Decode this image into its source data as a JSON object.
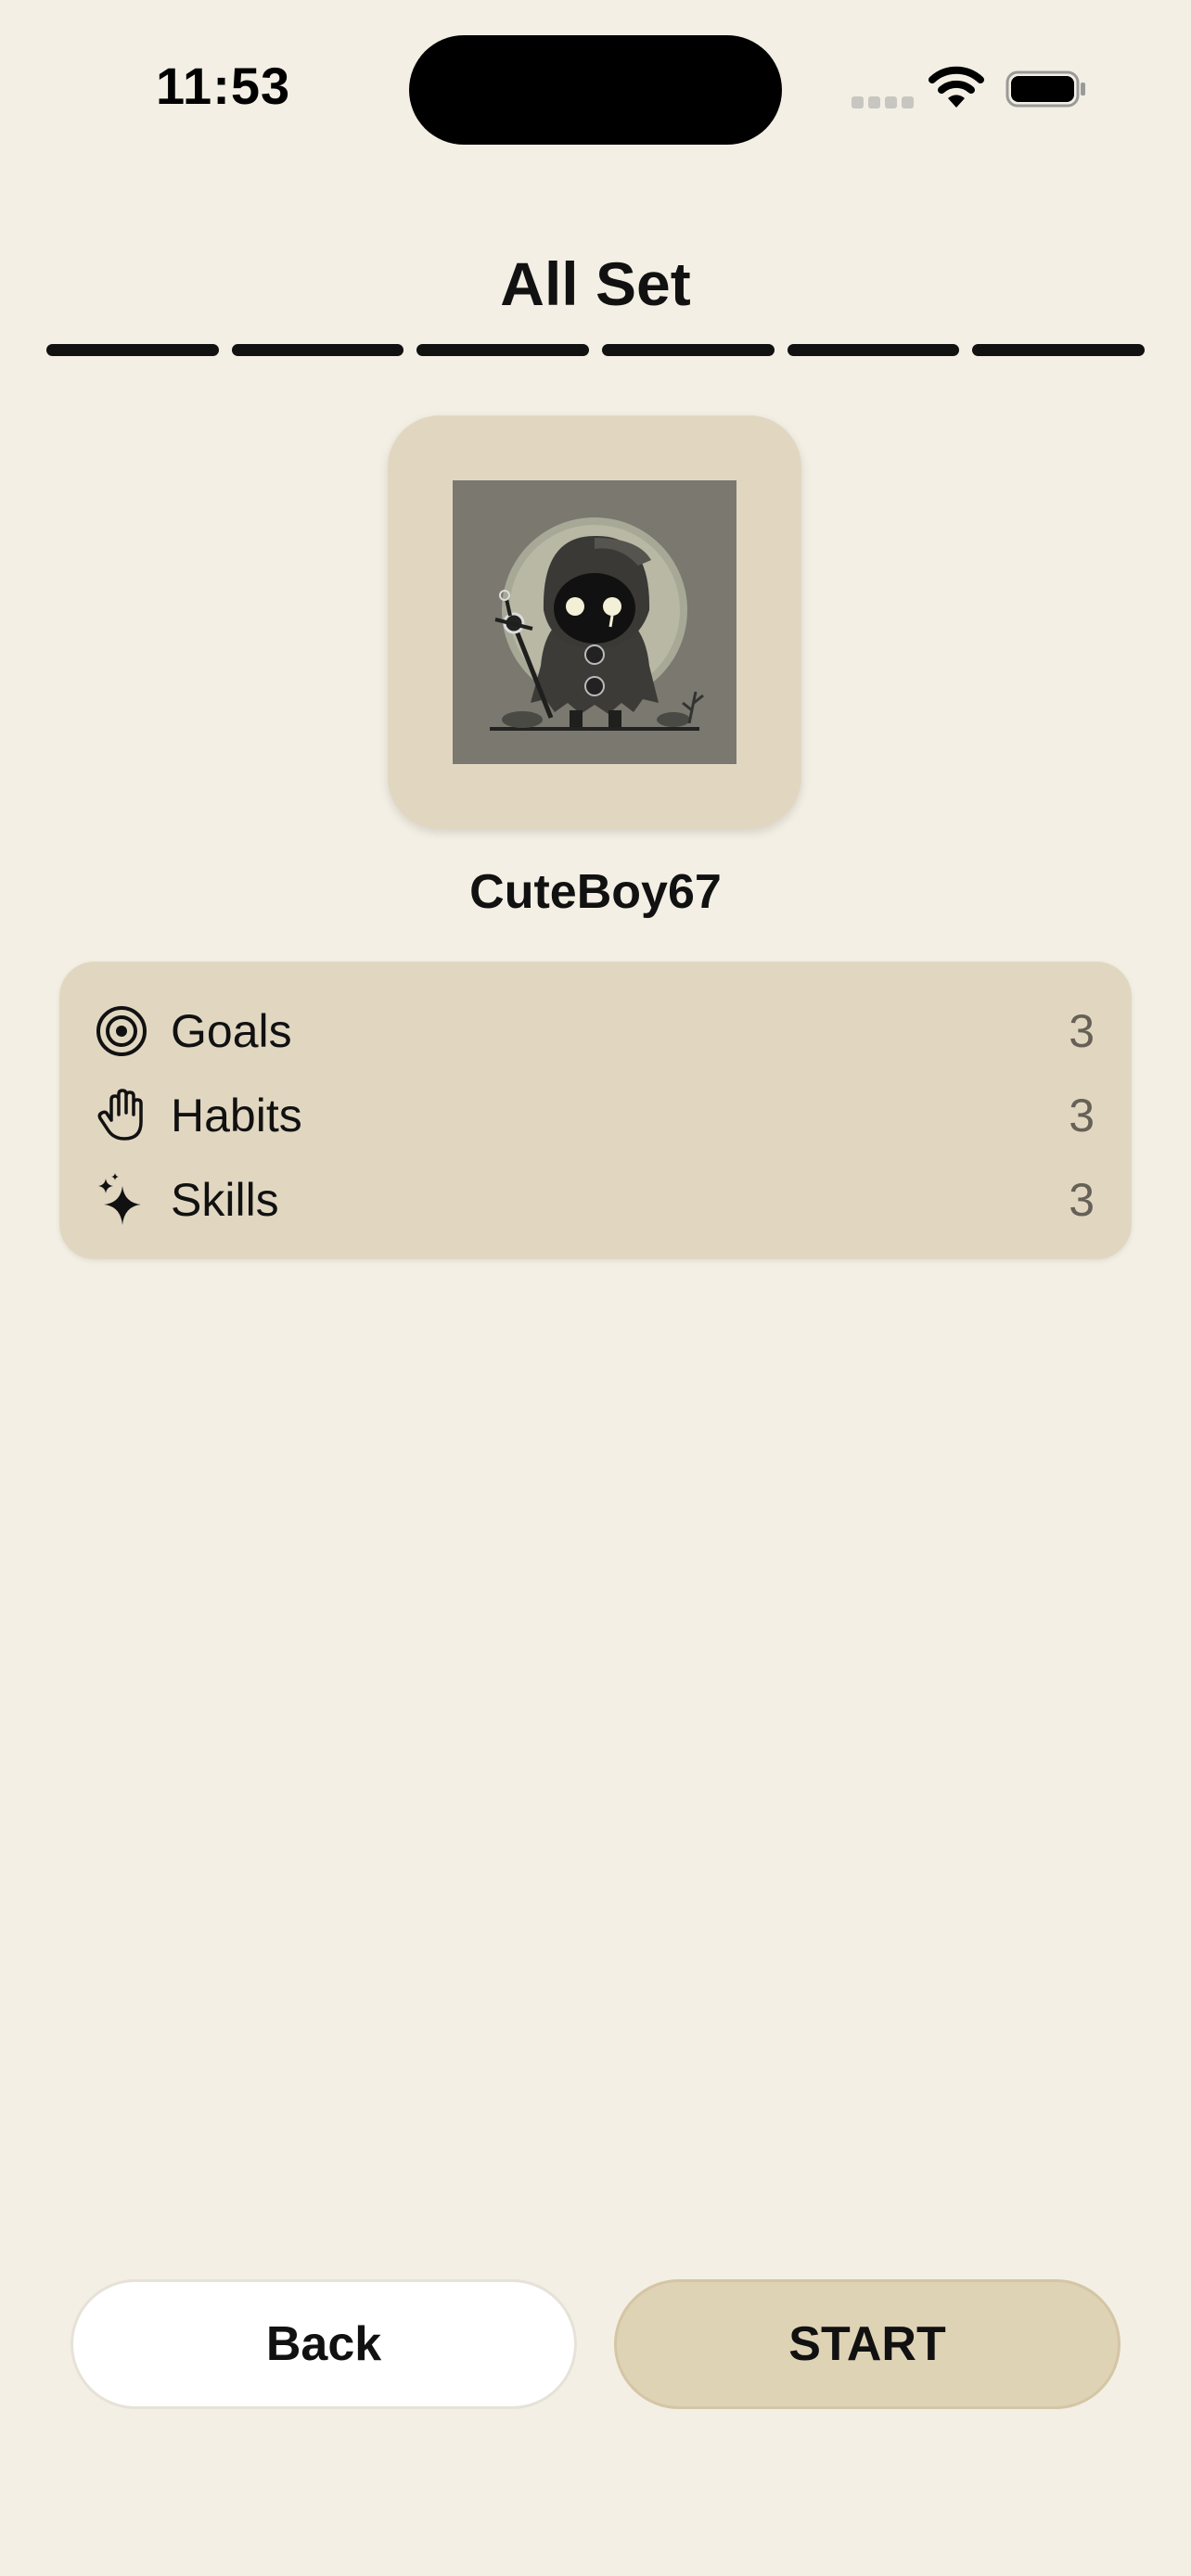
{
  "status_bar": {
    "time": "11:53"
  },
  "header": {
    "title": "All Set",
    "progress": {
      "completed_steps": 6,
      "total_steps": 6
    }
  },
  "profile": {
    "avatar_description": "hooded-reaper-avatar",
    "username": "CuteBoy67"
  },
  "stats": [
    {
      "icon": "target-icon",
      "label": "Goals",
      "count": "3"
    },
    {
      "icon": "hand-icon",
      "label": "Habits",
      "count": "3"
    },
    {
      "icon": "sparkle-icon",
      "label": "Skills",
      "count": "3"
    }
  ],
  "actions": {
    "back_label": "Back",
    "start_label": "START"
  },
  "colors": {
    "background": "#f3efe4",
    "card": "#e1d7c1",
    "start_button": "#dfd3b6",
    "text": "#111111"
  }
}
